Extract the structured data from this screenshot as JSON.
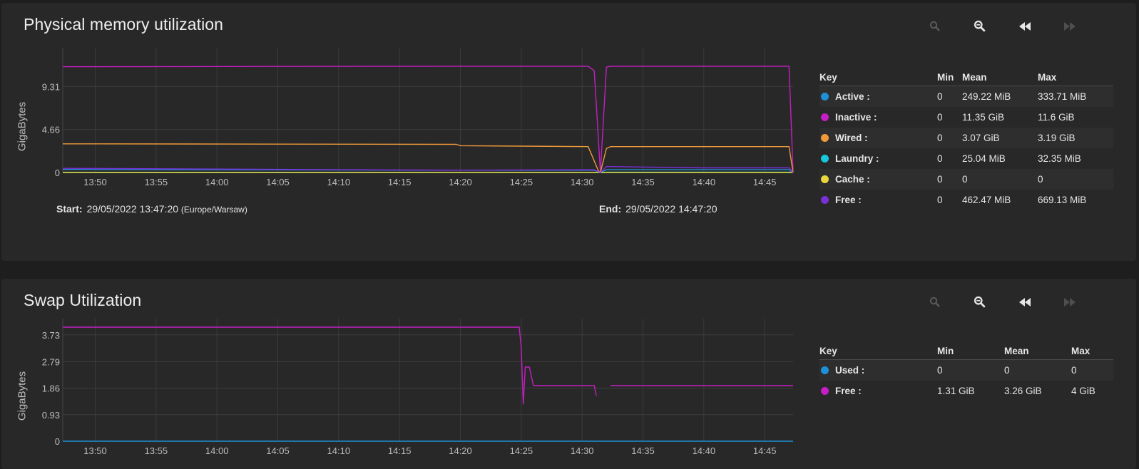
{
  "colors": {
    "active": "#1e90d6",
    "inactive": "#c41ec4",
    "wired": "#f09a3a",
    "laundry": "#17c8d8",
    "cache": "#e8d63c",
    "free": "#7b2fd6",
    "swap_used": "#1e90d6",
    "swap_free": "#c41ec4"
  },
  "toolbar_icons": [
    "zoom-in-icon",
    "zoom-out-icon",
    "step-back-icon",
    "step-forward-icon"
  ],
  "memory": {
    "title": "Physical memory utilization",
    "ylabel": "GigaBytes",
    "start_label": "Start:",
    "start_value": "29/05/2022 13:47:20",
    "timezone": "(Europe/Warsaw)",
    "end_label": "End:",
    "end_value": "29/05/2022 14:47:20",
    "legend": {
      "headers": [
        "Key",
        "Min",
        "Mean",
        "Max"
      ],
      "rows": [
        {
          "key": "Active :",
          "min": "0",
          "mean": "249.22 MiB",
          "max": "333.71 MiB",
          "color": "#1e90d6"
        },
        {
          "key": "Inactive :",
          "min": "0",
          "mean": "11.35 GiB",
          "max": "11.6 GiB",
          "color": "#c41ec4"
        },
        {
          "key": "Wired :",
          "min": "0",
          "mean": "3.07 GiB",
          "max": "3.19 GiB",
          "color": "#f09a3a"
        },
        {
          "key": "Laundry :",
          "min": "0",
          "mean": "25.04 MiB",
          "max": "32.35 MiB",
          "color": "#17c8d8"
        },
        {
          "key": "Cache :",
          "min": "0",
          "mean": "0",
          "max": "0",
          "color": "#e8d63c"
        },
        {
          "key": "Free :",
          "min": "0",
          "mean": "462.47 MiB",
          "max": "669.13 MiB",
          "color": "#7b2fd6"
        }
      ]
    }
  },
  "swap": {
    "title": "Swap Utilization",
    "ylabel": "GigaBytes",
    "legend": {
      "headers": [
        "Key",
        "Min",
        "Mean",
        "Max"
      ],
      "rows": [
        {
          "key": "Used :",
          "min": "0",
          "mean": "0",
          "max": "0",
          "color": "#1e90d6"
        },
        {
          "key": "Free :",
          "min": "1.31 GiB",
          "mean": "3.26 GiB",
          "max": "4 GiB",
          "color": "#c41ec4"
        }
      ]
    }
  },
  "chart_data": [
    {
      "type": "line",
      "title": "Physical memory utilization",
      "ylabel": "GigaBytes",
      "xlim": [
        "13:47:20",
        "14:47:20"
      ],
      "ylim": [
        0,
        13.5
      ],
      "x_ticks": [
        "13:50",
        "13:55",
        "14:00",
        "14:05",
        "14:10",
        "14:15",
        "14:20",
        "14:25",
        "14:30",
        "14:35",
        "14:40",
        "14:45"
      ],
      "y_ticks": [
        0,
        4.66,
        9.31
      ],
      "grid": true,
      "legend": "right",
      "series": [
        {
          "name": "Active",
          "color": "#1e90d6",
          "points": [
            [
              "13:47:20",
              0.33
            ],
            [
              "14:20:00",
              0.25
            ],
            [
              "14:31:00",
              0.25
            ],
            [
              "14:31:30",
              0
            ],
            [
              "14:32:00",
              0.3
            ],
            [
              "14:47:00",
              0.3
            ],
            [
              "14:47:20",
              0
            ]
          ]
        },
        {
          "name": "Inactive",
          "color": "#c41ec4",
          "points": [
            [
              "13:47:20",
              11.45
            ],
            [
              "14:20:00",
              11.5
            ],
            [
              "14:30:30",
              11.5
            ],
            [
              "14:31:00",
              11.0
            ],
            [
              "14:31:30",
              0
            ],
            [
              "14:32:00",
              11.4
            ],
            [
              "14:32:20",
              11.5
            ],
            [
              "14:47:00",
              11.5
            ],
            [
              "14:47:20",
              0
            ]
          ]
        },
        {
          "name": "Wired",
          "color": "#f09a3a",
          "points": [
            [
              "13:47:20",
              3.1
            ],
            [
              "14:19:40",
              3.05
            ],
            [
              "14:20:00",
              2.9
            ],
            [
              "14:30:30",
              2.8
            ],
            [
              "14:31:20",
              0.2
            ],
            [
              "14:31:30",
              0
            ],
            [
              "14:32:00",
              2.6
            ],
            [
              "14:32:20",
              2.8
            ],
            [
              "14:47:00",
              2.8
            ],
            [
              "14:47:20",
              0
            ]
          ]
        },
        {
          "name": "Laundry",
          "color": "#17c8d8",
          "points": [
            [
              "13:47:20",
              0.02
            ],
            [
              "14:31:00",
              0.02
            ],
            [
              "14:31:30",
              0
            ],
            [
              "14:32:00",
              0.03
            ],
            [
              "14:47:00",
              0.03
            ],
            [
              "14:47:20",
              0
            ]
          ]
        },
        {
          "name": "Cache",
          "color": "#e8d63c",
          "points": [
            [
              "13:47:20",
              0
            ],
            [
              "14:47:20",
              0
            ]
          ]
        },
        {
          "name": "Free",
          "color": "#7b2fd6",
          "points": [
            [
              "13:47:20",
              0.45
            ],
            [
              "14:20:00",
              0.25
            ],
            [
              "14:31:00",
              0.3
            ],
            [
              "14:31:30",
              0
            ],
            [
              "14:32:00",
              0.65
            ],
            [
              "14:40:00",
              0.5
            ],
            [
              "14:47:00",
              0.5
            ],
            [
              "14:47:20",
              0
            ]
          ]
        }
      ]
    },
    {
      "type": "line",
      "title": "Swap Utilization",
      "ylabel": "GigaBytes",
      "xlim": [
        "13:47:20",
        "14:47:20"
      ],
      "ylim": [
        0,
        4.3
      ],
      "x_ticks": [
        "13:50",
        "13:55",
        "14:00",
        "14:05",
        "14:10",
        "14:15",
        "14:20",
        "14:25",
        "14:30",
        "14:35",
        "14:40",
        "14:45"
      ],
      "y_ticks": [
        0,
        0.93,
        1.86,
        2.79,
        3.73
      ],
      "grid": true,
      "legend": "right",
      "series": [
        {
          "name": "Used",
          "color": "#1e90d6",
          "points": [
            [
              "13:47:20",
              0
            ],
            [
              "14:47:20",
              0
            ]
          ]
        },
        {
          "name": "Free",
          "color": "#c41ec4",
          "points": [
            [
              "13:47:20",
              4.0
            ],
            [
              "14:24:50",
              4.0
            ],
            [
              "14:25:00",
              3.3
            ],
            [
              "14:25:10",
              1.3
            ],
            [
              "14:25:20",
              2.6
            ],
            [
              "14:25:40",
              2.6
            ],
            [
              "14:26:00",
              1.95
            ],
            [
              "14:31:00",
              1.95
            ],
            [
              "14:31:10",
              1.6
            ],
            [
              "14:32:00",
              null
            ],
            [
              "14:32:20",
              1.95
            ],
            [
              "14:47:20",
              1.95
            ]
          ]
        }
      ]
    }
  ]
}
